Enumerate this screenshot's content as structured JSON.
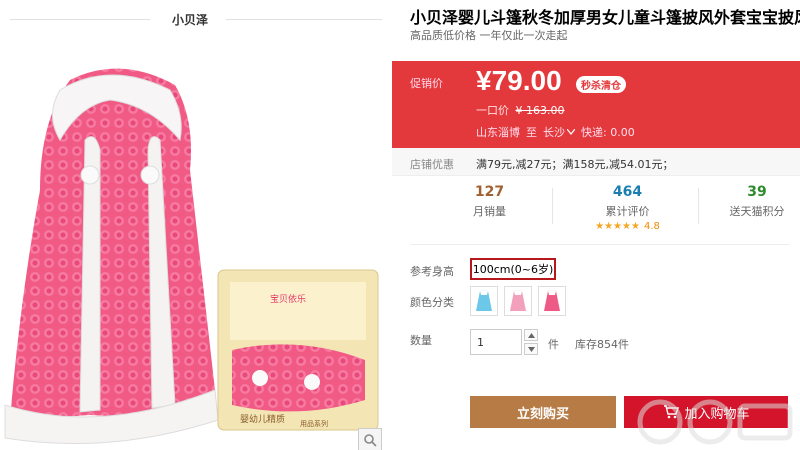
{
  "shop": {
    "name": "小贝泽"
  },
  "product": {
    "title": "小贝泽婴儿斗篷秋冬加厚男女儿童斗篷披风外套宝宝披风",
    "subtitle": "高品质低价格 一年仅此一次走起",
    "package_brand": "宝贝依乐",
    "package_line1": "婴幼儿精质",
    "package_line2": "用品系列"
  },
  "price": {
    "label": "促销价",
    "current": "¥79.00",
    "badge": "秒杀清仓",
    "orig_label": "一口价",
    "orig_value": "¥ 163.00",
    "ship_from": "山东淄博",
    "ship_to_word": "至",
    "ship_to": "长沙",
    "ship_fee": "快递: 0.00"
  },
  "promo": {
    "label": "店铺优惠",
    "text": "满79元,减27元；满158元,减54.01元；"
  },
  "stats": {
    "monthly_sales": "127",
    "monthly_sales_label": "月销量",
    "reviews": "464",
    "reviews_label": "累计评价",
    "rating_stars": "★★★★★",
    "rating": "4.8",
    "points": "39",
    "points_label": "送天猫积分"
  },
  "options": {
    "size_label": "参考身高",
    "size_value": "100cm(0~6岁)",
    "color_label": "颜色分类",
    "qty_label": "数量",
    "qty_value": "1",
    "qty_unit": "件",
    "stock": "库存854件"
  },
  "actions": {
    "buy_now": "立刻购买",
    "add_cart": "加入购物车"
  },
  "colors": {
    "accent_red": "#e4393c",
    "buy_brown": "#b77b46",
    "cart_red": "#d3142a"
  }
}
